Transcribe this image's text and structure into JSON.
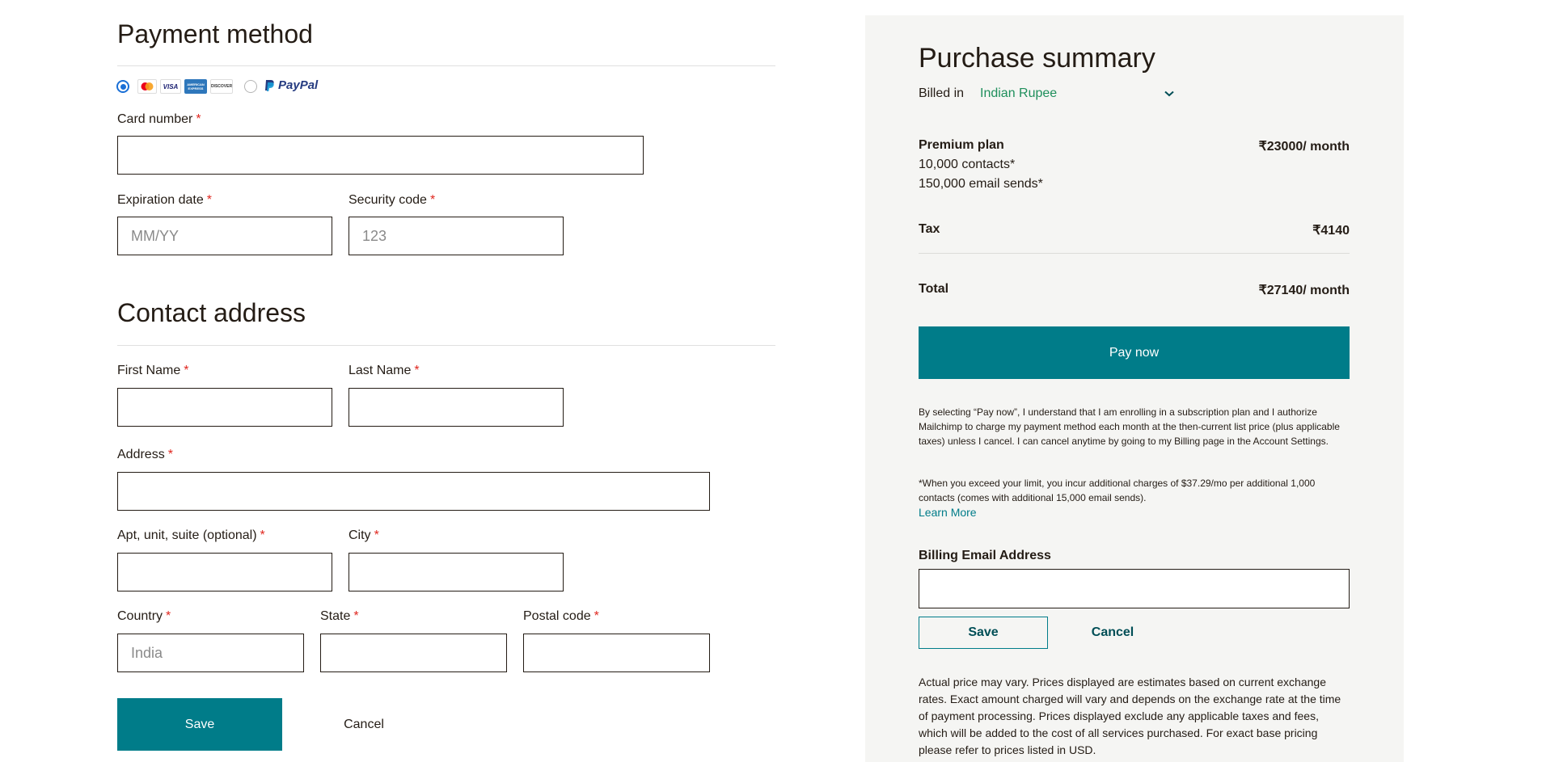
{
  "payment": {
    "title": "Payment method",
    "cards": {
      "mastercard": "",
      "visa": "VISA",
      "amex": "AMERICAN EXPRESS",
      "discover": "DISCOVER"
    },
    "paypal_label": "PayPal",
    "card_number_label": "Card number",
    "card_number_value": "",
    "expiration_label": "Expiration date",
    "expiration_placeholder": "MM/YY",
    "security_label": "Security code",
    "security_placeholder": "123"
  },
  "contact": {
    "title": "Contact address",
    "first_name_label": "First Name",
    "last_name_label": "Last Name",
    "address_label": "Address",
    "apt_label": "Apt, unit, suite (optional)",
    "city_label": "City",
    "country_label": "Country",
    "country_placeholder": "India",
    "state_label": "State",
    "postal_label": "Postal code",
    "save_label": "Save",
    "cancel_label": "Cancel"
  },
  "summary": {
    "title": "Purchase summary",
    "billed_in_label": "Billed in",
    "currency": "Indian Rupee",
    "plan_name": "Premium plan",
    "plan_price": "₹23000/ month",
    "contacts": "10,000 contacts*",
    "email_sends": "150,000 email sends*",
    "tax_label": "Tax",
    "tax_value": "₹4140",
    "total_label": "Total",
    "total_value": "₹27140/ month",
    "pay_now_label": "Pay now",
    "consent_text": "By selecting “Pay now”, I understand that I am enrolling in a subscription plan and I authorize Mailchimp to charge my payment method each month at the then-current list price (plus applicable taxes) unless I cancel. I can cancel anytime by going to my Billing page in the Account Settings.",
    "limit_text": "*When you exceed your limit, you incur additional charges of $37.29/mo per additional 1,000 contacts (comes with additional 15,000 email sends).",
    "learn_more": "Learn More",
    "billing_email_label": "Billing Email Address",
    "billing_email_value": "",
    "save_label": "Save",
    "cancel_label": "Cancel",
    "disclaimer": "Actual price may vary. Prices displayed are estimates based on current exchange rates. Exact amount charged will vary and depends on the exchange rate at the time of payment processing. Prices displayed exclude any applicable taxes and fees, which will be added to the cost of all services purchased. For exact base pricing please refer to prices listed in USD."
  },
  "colors": {
    "accent": "#007c89",
    "required": "#e0271f",
    "panel_bg": "#f5f5f3"
  }
}
